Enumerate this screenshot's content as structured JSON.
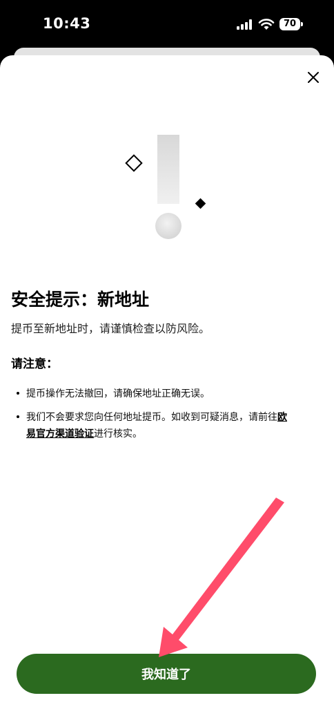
{
  "status_bar": {
    "time": "10:43",
    "battery_level": "70"
  },
  "modal": {
    "title": "安全提示：新地址",
    "subtitle": "提币至新地址时，请谨慎检查以防风险。",
    "note_heading": "请注意：",
    "bullets": [
      {
        "text": "提币操作无法撤回，请确保地址正确无误。"
      },
      {
        "line1_prefix": "我们不会要求您向任何地址提币。如收到可疑消息，请前往",
        "link_part1": "欧",
        "link_part2": "易官方渠道验证",
        "line2_suffix": "进行核实。"
      }
    ],
    "primary_button": "我知道了"
  },
  "colors": {
    "primary_button": "#2b6a1f",
    "annotation_arrow": "#ff4c6a"
  },
  "icons": [
    "signal-icon",
    "wifi-icon",
    "battery-icon",
    "close-icon",
    "warning-exclamation-illustration",
    "annotation-arrow"
  ]
}
